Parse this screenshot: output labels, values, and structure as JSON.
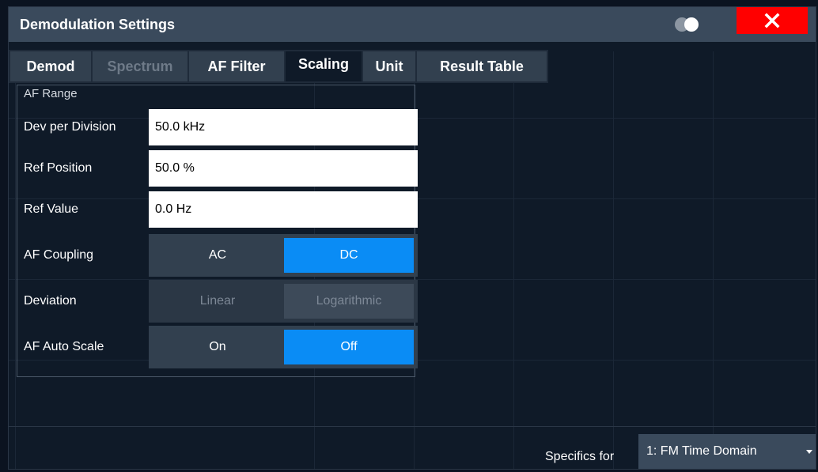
{
  "dialog": {
    "title": "Demodulation Settings"
  },
  "tabs": [
    {
      "label": "Demod",
      "state": "normal"
    },
    {
      "label": "Spectrum",
      "state": "disabled"
    },
    {
      "label": "AF Filter",
      "state": "normal"
    },
    {
      "label": "Scaling",
      "state": "active"
    },
    {
      "label": "Unit",
      "state": "normal"
    },
    {
      "label": "Result Table",
      "state": "normal"
    }
  ],
  "af_range": {
    "label": "AF Range",
    "dev_per_division": {
      "label": "Dev per Division",
      "value": "50.0 kHz"
    },
    "ref_position": {
      "label": "Ref Position",
      "value": "50.0 %"
    },
    "ref_value": {
      "label": "Ref Value",
      "value": "0.0 Hz"
    },
    "af_coupling": {
      "label": "AF Coupling",
      "options": [
        "AC",
        "DC"
      ],
      "selected": "DC"
    },
    "deviation": {
      "label": "Deviation",
      "options": [
        "Linear",
        "Logarithmic"
      ],
      "enabled": false
    },
    "af_auto_scale": {
      "label": "AF Auto Scale",
      "options": [
        "On",
        "Off"
      ],
      "selected": "Off"
    }
  },
  "specifics": {
    "label": "Specifics for",
    "selected": "1: FM Time Domain"
  },
  "colors": {
    "title_bar": "#3a4a5c",
    "close_button": "#ff0000",
    "accent": "#0a8cf5",
    "background": "#0f1a28"
  },
  "icons": {
    "close": "close-icon",
    "toggle": "toggle-icon",
    "dropdown": "chevron-down-icon"
  }
}
